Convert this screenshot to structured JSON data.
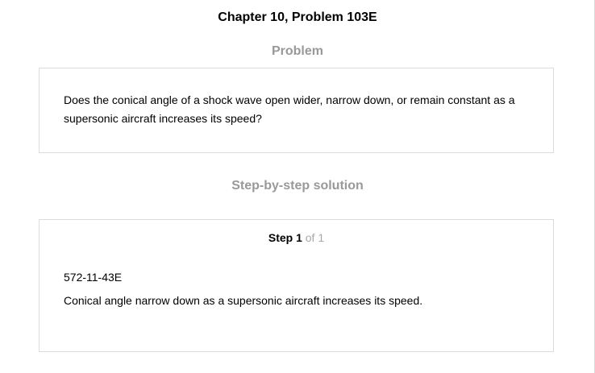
{
  "chapter_title": "Chapter 10, Problem 103E",
  "problem": {
    "heading": "Problem",
    "text": "Does the conical angle of a shock wave open wider, narrow down, or remain constant as a supersonic aircraft increases its speed?"
  },
  "solution": {
    "heading": "Step-by-step solution",
    "step": {
      "label": "Step 1",
      "of": "of 1"
    },
    "reference": "572-11-43E",
    "answer": "Conical angle narrow down as a supersonic aircraft increases its speed."
  },
  "colors": {
    "heading_gray": "#999999",
    "border": "#dcdcdc",
    "step_of_gray": "#a8a8a8"
  }
}
